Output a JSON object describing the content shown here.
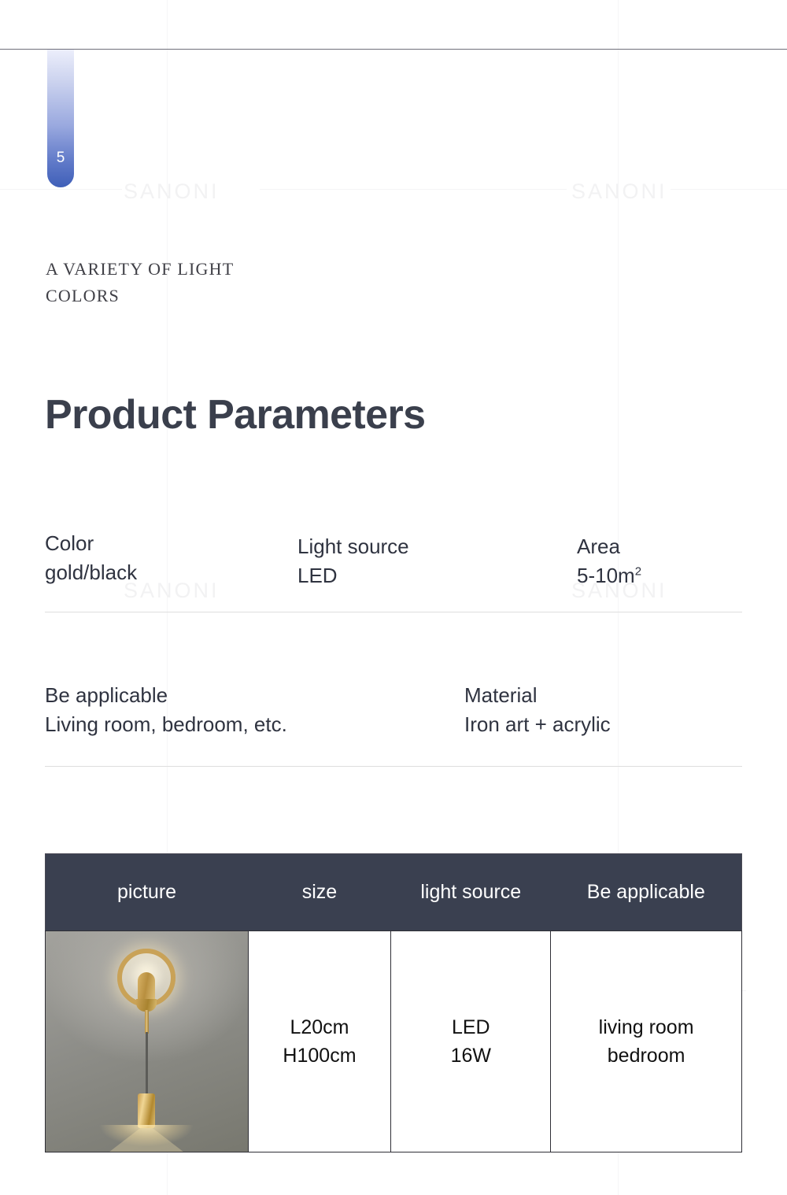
{
  "page": {
    "number": "5",
    "brand_watermark": "SANONI"
  },
  "eyebrow": {
    "line1": "A VARIETY OF LIGHT",
    "line2": "COLORS"
  },
  "title": "Product Parameters",
  "specs": {
    "row1": [
      {
        "label": "Color",
        "value": "gold/black"
      },
      {
        "label": "Light source",
        "value": "LED"
      },
      {
        "label": "Area",
        "value": "5-10m",
        "sup": "2"
      }
    ],
    "row2": [
      {
        "label": "Be applicable",
        "value": "Living room, bedroom, etc."
      },
      {
        "label": "Material",
        "value": "Iron art + acrylic"
      }
    ]
  },
  "table": {
    "headers": [
      "picture",
      "size",
      "light source",
      "Be applicable"
    ],
    "rows": [
      {
        "picture_alt": "gold-ring-wall-lamp",
        "size_line1": "L20cm",
        "size_line2": "H100cm",
        "light_source_line1": "LED",
        "light_source_line2": "16W",
        "applicable_line1": "living room",
        "applicable_line2": "bedroom"
      }
    ]
  },
  "colors": {
    "header_bg": "#3a4050",
    "title": "#3a3f4c",
    "badge_bottom": "#3f5fb8",
    "divider": "#dedede",
    "gold": "#c9a257"
  }
}
